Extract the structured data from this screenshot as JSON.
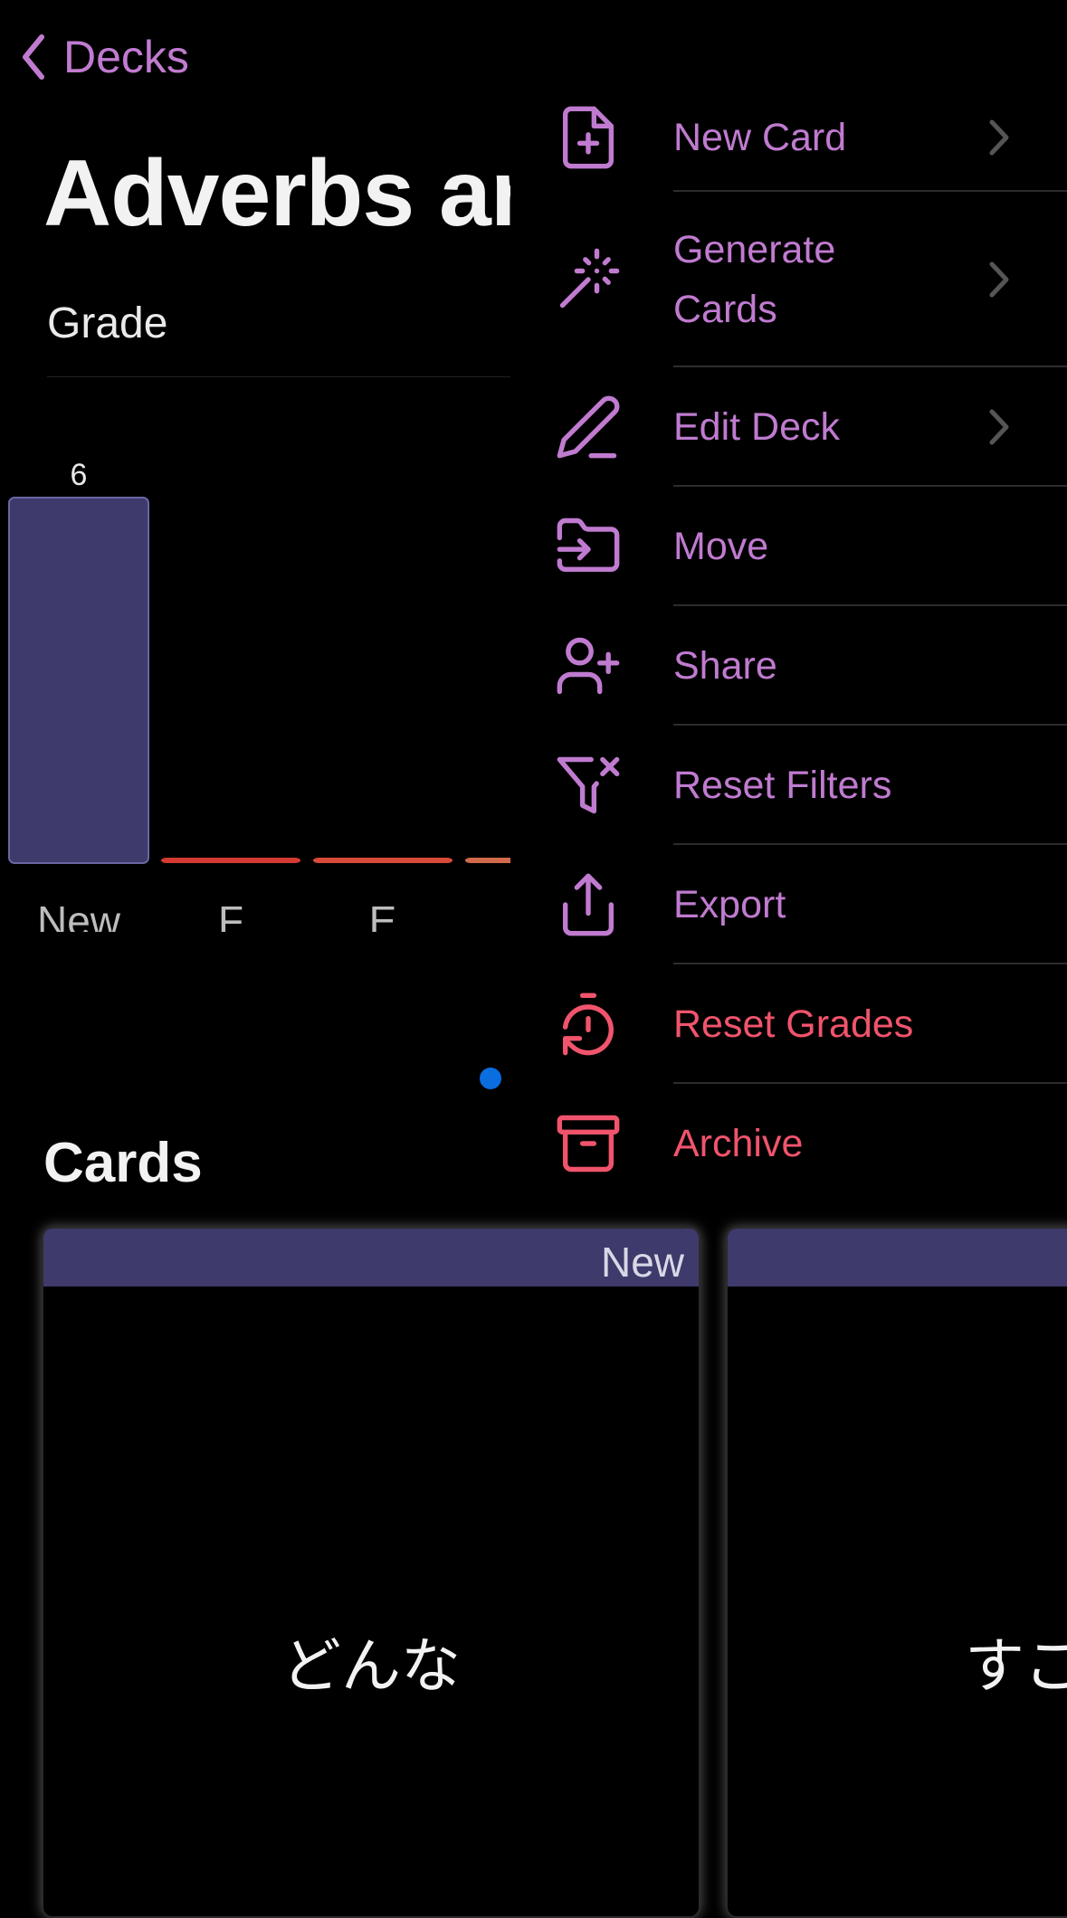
{
  "nav": {
    "back_label": "Decks"
  },
  "deck": {
    "title": "Adverbs ar"
  },
  "grade": {
    "label": "Grade"
  },
  "chart_data": {
    "type": "bar",
    "categories": [
      "New",
      "F",
      "E",
      ""
    ],
    "values": [
      6,
      0,
      0,
      0
    ],
    "data_labels": [
      "6",
      "",
      "",
      ""
    ],
    "ylim": [
      0,
      6
    ],
    "colors": [
      "#3e3a6b",
      "#d23a32",
      "#d84a3a",
      "#d06a4a"
    ]
  },
  "cards_section": {
    "title": "Cards",
    "items": [
      {
        "badge": "New",
        "front": "どんな"
      },
      {
        "badge": "",
        "front": "すご"
      }
    ]
  },
  "menu": {
    "items": [
      {
        "label": "New Card",
        "icon": "file-plus-icon",
        "submenu": true,
        "destructive": false
      },
      {
        "label": "Generate\nCards",
        "icon": "magic-wand-icon",
        "submenu": true,
        "destructive": false
      },
      {
        "label": "Edit Deck",
        "icon": "pencil-icon",
        "submenu": true,
        "destructive": false
      },
      {
        "label": "Move",
        "icon": "folder-input-icon",
        "submenu": false,
        "destructive": false
      },
      {
        "label": "Share",
        "icon": "user-plus-icon",
        "submenu": false,
        "destructive": false
      },
      {
        "label": "Reset Filters",
        "icon": "filter-x-icon",
        "submenu": false,
        "destructive": false
      },
      {
        "label": "Export",
        "icon": "upload-icon",
        "submenu": false,
        "destructive": false
      },
      {
        "label": "Reset Grades",
        "icon": "timer-reset-icon",
        "submenu": false,
        "destructive": true
      },
      {
        "label": "Archive",
        "icon": "archive-icon",
        "submenu": false,
        "destructive": true
      }
    ]
  },
  "colors": {
    "accent": "#c07bd0",
    "destructive": "#f0546c",
    "card_header": "#3e3a6b",
    "blue_dot": "#0a6de0"
  }
}
